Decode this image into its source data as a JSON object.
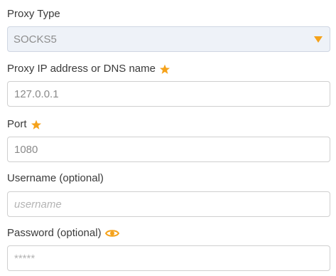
{
  "proxy_type": {
    "label": "Proxy Type",
    "selected": "SOCKS5",
    "icon": "chevron-down-icon",
    "accent_color": "#f5a21a"
  },
  "proxy_address": {
    "label": "Proxy IP address or DNS name",
    "value": "127.0.0.1",
    "required_icon": "star-icon"
  },
  "port": {
    "label": "Port",
    "value": "1080",
    "required_icon": "star-icon"
  },
  "username": {
    "label": "Username (optional)",
    "placeholder": "username",
    "value": ""
  },
  "password": {
    "label": "Password (optional)",
    "placeholder": "*****",
    "value": "",
    "toggle_icon": "eye-icon"
  }
}
